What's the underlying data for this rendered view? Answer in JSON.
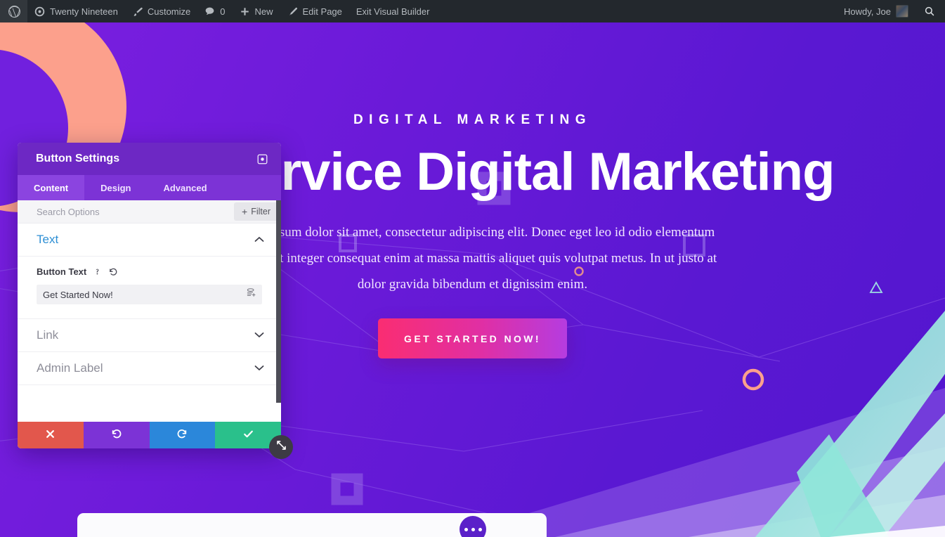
{
  "adminbar": {
    "logo_icon": "wordpress-logo-icon",
    "items": [
      {
        "label": "Twenty Nineteen",
        "icon": "site-dashboard-icon",
        "name": "adminbar-site-name"
      },
      {
        "label": "Customize",
        "icon": "paintbrush-icon",
        "name": "adminbar-customize"
      },
      {
        "label": "0",
        "icon": "comment-bubble-icon",
        "name": "adminbar-comments"
      },
      {
        "label": "New",
        "icon": "plus-icon",
        "name": "adminbar-new"
      },
      {
        "label": "Edit Page",
        "icon": "pencil-icon",
        "name": "adminbar-edit-page"
      },
      {
        "label": "Exit Visual Builder",
        "icon": "",
        "name": "adminbar-exit-visual-builder"
      }
    ],
    "howdy": "Howdy, Joe",
    "search_icon": "search-icon"
  },
  "hero": {
    "eyebrow": "DIGITAL MARKETING",
    "headline": "Full Service Digital Marketing",
    "paragraph": "Lorem ipsum dolor sit amet, consectetur adipiscing elit. Donec eget leo id odio elementum facilisis ut integer consequat enim at massa mattis aliquet quis volutpat metus. In ut justo at dolor gravida bibendum et dignissim enim.",
    "cta_label": "GET STARTED NOW!",
    "dots_label": "•••"
  },
  "modal": {
    "title": "Button Settings",
    "expand_icon": "fullscreen-expand-icon",
    "tabs": [
      {
        "label": "Content",
        "active": true
      },
      {
        "label": "Design",
        "active": false
      },
      {
        "label": "Advanced",
        "active": false
      }
    ],
    "search_placeholder": "Search Options",
    "search_value": "",
    "filter_label": "Filter",
    "filter_plus": "+",
    "sections": [
      {
        "key": "text",
        "label": "Text",
        "state": "open",
        "chevron": "chevron-up-icon"
      },
      {
        "key": "link",
        "label": "Link",
        "state": "closed",
        "chevron": "chevron-down-icon"
      },
      {
        "key": "admin_label",
        "label": "Admin Label",
        "state": "closed",
        "chevron": "chevron-down-icon"
      }
    ],
    "button_text_field": {
      "label": "Button Text",
      "help_icon": "question-mark-icon",
      "reset_icon": "reset-undo-icon",
      "value": "Get Started Now!",
      "placeholder": "",
      "dynamic_icon": "dynamic-content-icon"
    },
    "footer_buttons": [
      {
        "name": "cancel-button",
        "icon": "close-x-icon",
        "color": "#e2574c"
      },
      {
        "name": "undo-button",
        "icon": "undo-arrow-icon",
        "color": "#7c33d6"
      },
      {
        "name": "redo-button",
        "icon": "redo-arrow-icon",
        "color": "#2b87da"
      },
      {
        "name": "save-button",
        "icon": "checkmark-icon",
        "color": "#2ac08b"
      }
    ],
    "resize_icon": "resize-diagonal-icon"
  },
  "colors": {
    "adminbar_bg": "#23282d",
    "page_purple": "#6a1ad8",
    "modal_header": "#6d28c4",
    "tab_bar": "#7c33d6",
    "tab_active": "#8b44e0",
    "cta_gradient_from": "#fa2d72",
    "cta_gradient_to": "#b53ce0",
    "accent_salmon": "#fca08c",
    "accent_teal": "#6fd9cc",
    "save_green": "#2ac08b",
    "cancel_red": "#e2574c",
    "redo_blue": "#2b87da"
  }
}
